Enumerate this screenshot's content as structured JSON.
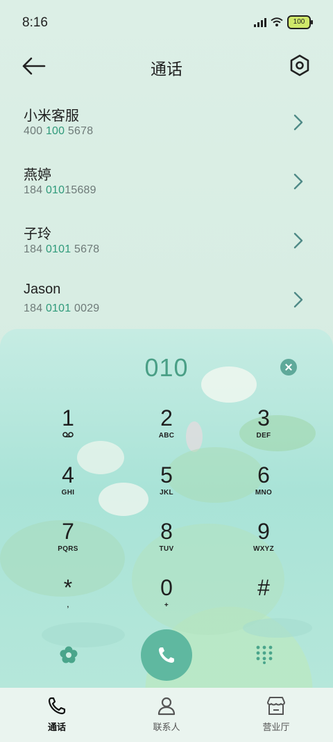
{
  "status": {
    "time": "8:16",
    "battery": "100"
  },
  "header": {
    "title": "通话"
  },
  "contacts": [
    {
      "name": "小米客服",
      "num_pre": "400 ",
      "num_hl": "100",
      "num_post": " 5678"
    },
    {
      "name": "燕婷",
      "num_pre": "184 ",
      "num_hl": "010",
      "num_post": "15689"
    },
    {
      "name": "子玲",
      "num_pre": "184 ",
      "num_hl": "0101",
      "num_post": " 5678"
    },
    {
      "name": "Jason",
      "num_pre": "184 ",
      "num_hl": "0101",
      "num_post": " 0029"
    }
  ],
  "dialer": {
    "input": "010"
  },
  "keys": [
    {
      "digit": "1",
      "sub": ""
    },
    {
      "digit": "2",
      "sub": "ABC"
    },
    {
      "digit": "3",
      "sub": "DEF"
    },
    {
      "digit": "4",
      "sub": "GHI"
    },
    {
      "digit": "5",
      "sub": "JKL"
    },
    {
      "digit": "6",
      "sub": "MNO"
    },
    {
      "digit": "7",
      "sub": "PQRS"
    },
    {
      "digit": "8",
      "sub": "TUV"
    },
    {
      "digit": "9",
      "sub": "WXYZ"
    },
    {
      "digit": "*",
      "sub": ","
    },
    {
      "digit": "0",
      "sub": "+"
    },
    {
      "digit": "#",
      "sub": ""
    }
  ],
  "tabs": [
    {
      "label": "通话",
      "icon": "phone-icon"
    },
    {
      "label": "联系人",
      "icon": "person-icon"
    },
    {
      "label": "营业厅",
      "icon": "store-icon"
    }
  ],
  "colors": {
    "accent": "#2f9a7a",
    "call": "#5fb8a0"
  }
}
